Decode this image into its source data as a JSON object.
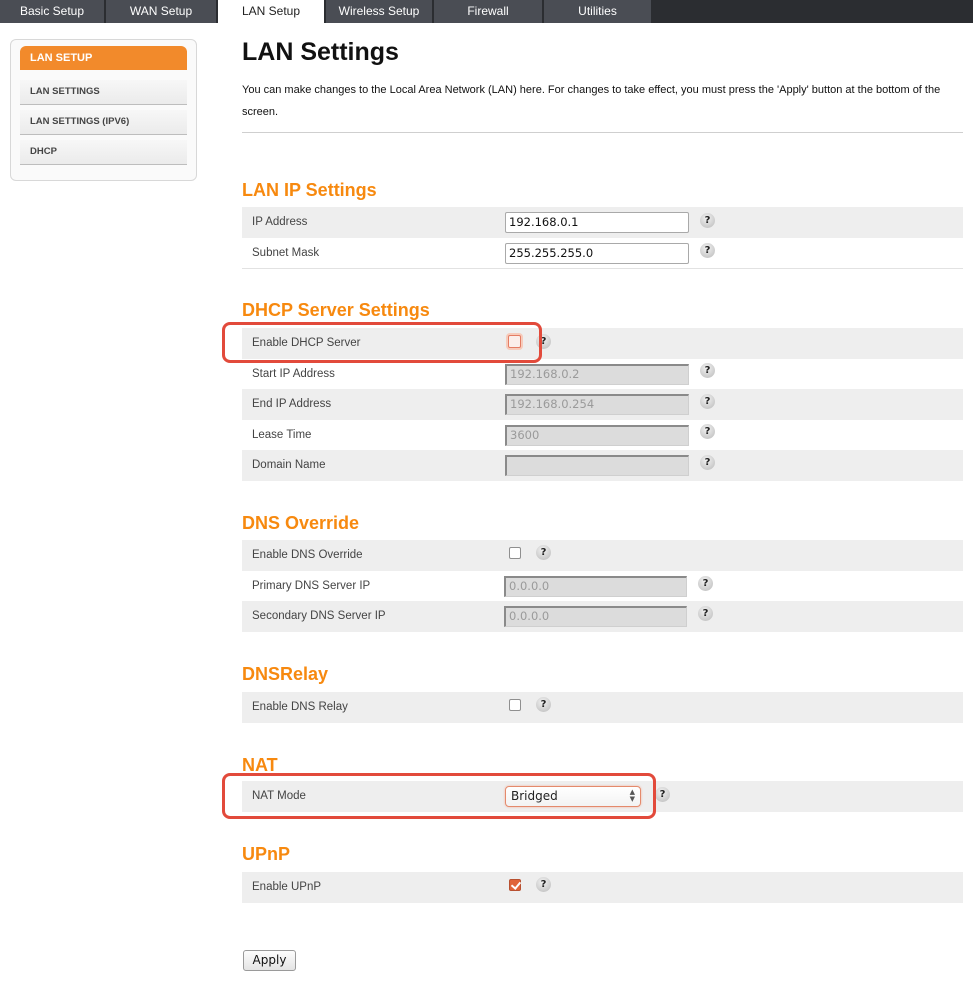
{
  "nav": {
    "tabs": [
      {
        "label": "Basic Setup",
        "active": false
      },
      {
        "label": "WAN Setup",
        "active": false
      },
      {
        "label": "LAN Setup",
        "active": true
      },
      {
        "label": "Wireless Setup",
        "active": false
      },
      {
        "label": "Firewall",
        "active": false
      },
      {
        "label": "Utilities",
        "active": false
      }
    ]
  },
  "sidebar": {
    "header": "LAN SETUP",
    "items": [
      {
        "label": "LAN SETTINGS"
      },
      {
        "label": "LAN SETTINGS (IPV6)"
      },
      {
        "label": "DHCP"
      }
    ]
  },
  "page": {
    "title": "LAN Settings",
    "intro": "You can make changes to the Local Area Network (LAN) here. For changes to take effect, you must press the 'Apply' button at the bottom of the screen."
  },
  "lan_ip": {
    "title": "LAN IP Settings",
    "ip_address": {
      "label": "IP Address",
      "value": "192.168.0.1"
    },
    "subnet_mask": {
      "label": "Subnet Mask",
      "value": "255.255.255.0"
    }
  },
  "dhcp": {
    "title": "DHCP Server Settings",
    "enable": {
      "label": "Enable DHCP Server",
      "checked": false
    },
    "start_ip": {
      "label": "Start IP Address",
      "value": "192.168.0.2"
    },
    "end_ip": {
      "label": "End IP Address",
      "value": "192.168.0.254"
    },
    "lease_time": {
      "label": "Lease Time",
      "value": "3600"
    },
    "domain_name": {
      "label": "Domain Name",
      "value": ""
    }
  },
  "dns_override": {
    "title": "DNS Override",
    "enable": {
      "label": "Enable DNS Override",
      "checked": false
    },
    "primary": {
      "label": "Primary DNS Server IP",
      "value": "0.0.0.0"
    },
    "secondary": {
      "label": "Secondary DNS Server IP",
      "value": "0.0.0.0"
    }
  },
  "dns_relay": {
    "title": "DNSRelay",
    "enable": {
      "label": "Enable DNS Relay",
      "checked": false
    }
  },
  "nat": {
    "title": "NAT",
    "mode": {
      "label": "NAT Mode",
      "selected": "Bridged"
    }
  },
  "upnp": {
    "title": "UPnP",
    "enable": {
      "label": "Enable UPnP",
      "checked": true
    }
  },
  "help_glyph": "?",
  "select_arrows": "▲\n▼",
  "apply_label": "Apply",
  "colors": {
    "accent_orange": "#f7890f",
    "sidebar_header": "#f28a2b",
    "annotation_red": "#e24a3b",
    "nav_bg": "#4a4d54"
  }
}
